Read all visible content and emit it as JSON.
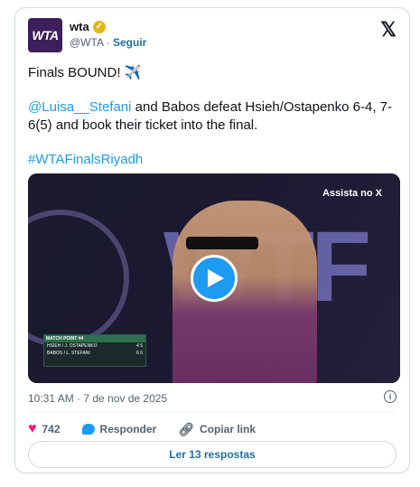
{
  "tweet": {
    "author_name": "wta",
    "author_handle": "@WTA",
    "separator": "·",
    "follow_label": "Seguir",
    "avatar_text": "WTA",
    "line1": "Finals BOUND! ✈️",
    "mention": "@Luisa__Stefani",
    "body": " and Babos defeat Hsieh/Ostapenko 6-4, 7-6(5) and book their ticket into the final.",
    "hashtag": "#WTAFinalsRiyadh",
    "timestamp": "10:31 AM · 7 de nov de 2025"
  },
  "media": {
    "watch_label": "Assista no X",
    "scoreboard": {
      "title": "MATCH POINT #4",
      "rows": [
        {
          "team": "HSIEH / J. OSTAPENKO",
          "sets": "4",
          "games": "5"
        },
        {
          "team": "BABOS / L. STEFANI",
          "sets": "6",
          "games": "6"
        }
      ]
    }
  },
  "actions": {
    "likes": "742",
    "reply_label": "Responder",
    "copy_label": "Copiar link",
    "read_replies": "Ler 13 respostas"
  },
  "colors": {
    "accent": "#1d9bf0",
    "heart": "#f91880",
    "verified": "#e2b719",
    "avatar_bg": "#3d1f5c"
  }
}
